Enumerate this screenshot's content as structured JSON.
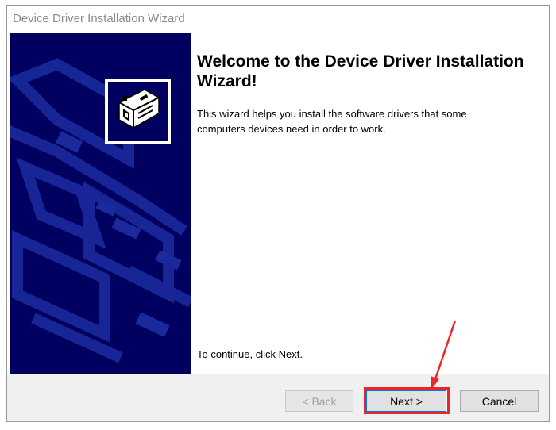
{
  "window": {
    "title": "Device Driver Installation Wizard"
  },
  "content": {
    "heading": "Welcome to the Device Driver Installation Wizard!",
    "description": "This wizard helps you install the software drivers that some computers devices need in order to work.",
    "continue_text": "To continue, click Next."
  },
  "buttons": {
    "back_label": "< Back",
    "next_label": "Next >",
    "cancel_label": "Cancel"
  },
  "colors": {
    "side_panel": "#000060",
    "annotation": "#e8262c"
  }
}
